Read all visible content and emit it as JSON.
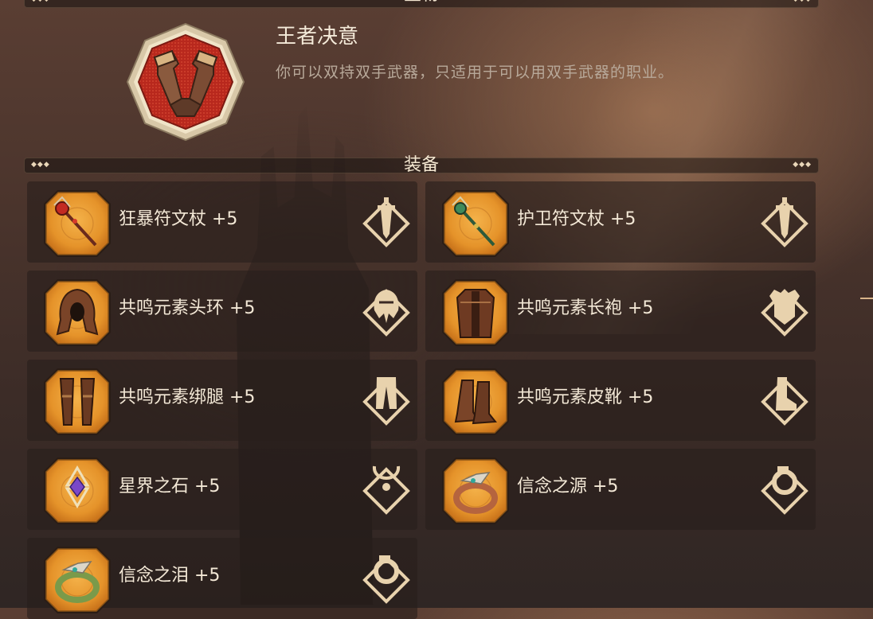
{
  "sections": {
    "relic_title": "圣物",
    "equipment_title": "装备"
  },
  "relic": {
    "name": "王者决意",
    "description": "你可以双持双手武器，只适用于可以用双手武器的职业。",
    "icon": "gauntlets-icon"
  },
  "equipment": [
    {
      "label": "狂暴符文杖 +5",
      "icon": "red-staff-icon",
      "slot": "weapon-slot-icon"
    },
    {
      "label": "护卫符文杖 +5",
      "icon": "green-staff-icon",
      "slot": "weapon-slot-icon"
    },
    {
      "label": "共鸣元素头环 +5",
      "icon": "hood-icon",
      "slot": "helmet-slot-icon"
    },
    {
      "label": "共鸣元素长袍 +5",
      "icon": "robe-icon",
      "slot": "armor-slot-icon"
    },
    {
      "label": "共鸣元素绑腿 +5",
      "icon": "leggings-icon",
      "slot": "legs-slot-icon"
    },
    {
      "label": "共鸣元素皮靴 +5",
      "icon": "boots-icon",
      "slot": "boots-slot-icon"
    },
    {
      "label": "星界之石 +5",
      "icon": "star-stone-icon",
      "slot": "necklace-slot-icon"
    },
    {
      "label": "信念之源 +5",
      "icon": "copper-ring-icon",
      "slot": "ring-slot-icon"
    },
    {
      "label": "信念之泪 +5",
      "icon": "green-ring-icon",
      "slot": "ring-slot-icon"
    }
  ],
  "colors": {
    "item_frame": "#e59a2a",
    "relic_frame": "#c2362a",
    "gold": "#e8d2ad",
    "text": "#f3e8d6",
    "description": "#b8a99a"
  }
}
